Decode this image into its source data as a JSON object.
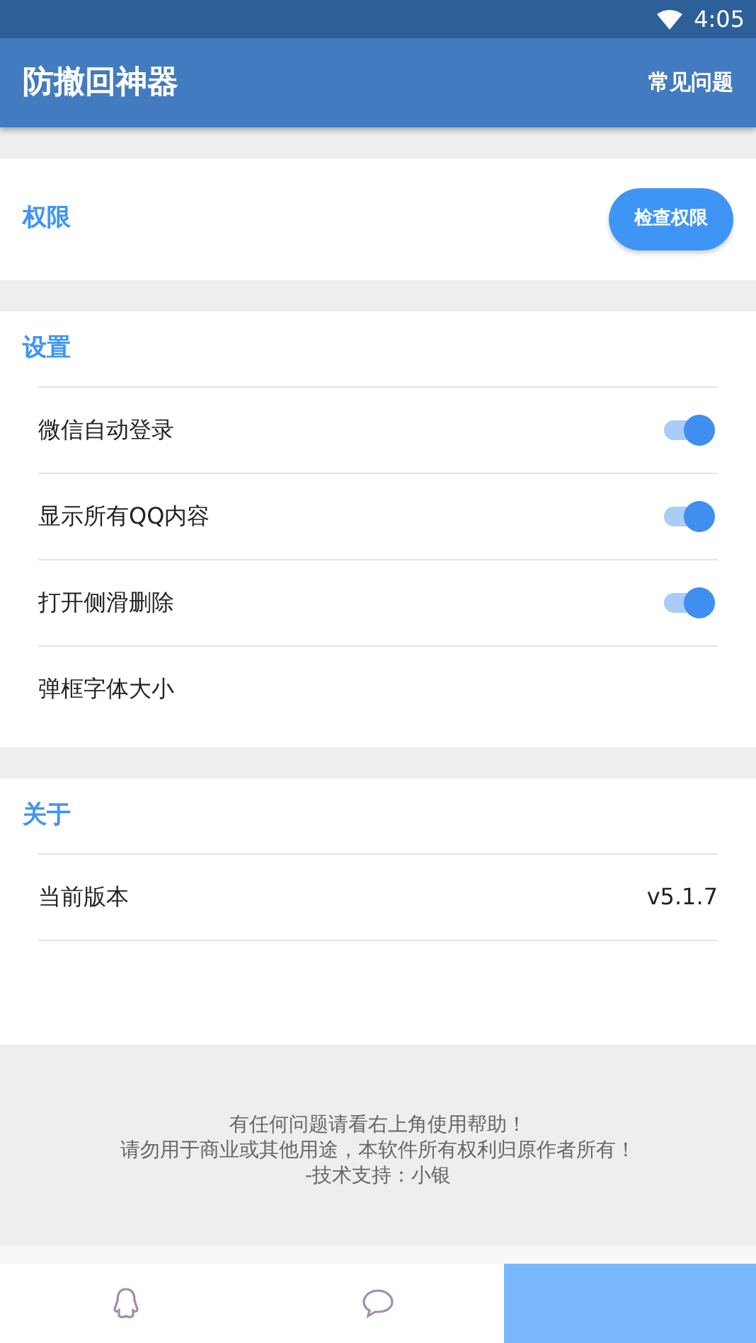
{
  "status_bar": {
    "time": "4:05"
  },
  "app_bar": {
    "title": "防撤回神器",
    "action": "常见问题"
  },
  "permission": {
    "title": "权限",
    "button": "检查权限"
  },
  "settings": {
    "title": "设置",
    "items": [
      {
        "kind": "switch",
        "label": "微信自动登录",
        "on": true
      },
      {
        "kind": "switch",
        "label": "显示所有QQ内容",
        "on": true
      },
      {
        "kind": "switch",
        "label": "打开侧滑删除",
        "on": true
      },
      {
        "kind": "plain",
        "label": "弹框字体大小"
      }
    ]
  },
  "about": {
    "title": "关于",
    "items": [
      {
        "kind": "value",
        "label": "当前版本",
        "value": "v5.1.7"
      }
    ]
  },
  "footer": [
    "有任何问题请看右上角使用帮助！",
    "请勿用于商业或其他用途，本软件所有权利归原作者所有！",
    "-技术支持：小银"
  ],
  "bottom_nav": [
    {
      "kind": "qq",
      "selected": false
    },
    {
      "kind": "chat",
      "selected": false
    },
    {
      "kind": "other",
      "selected": true
    }
  ]
}
